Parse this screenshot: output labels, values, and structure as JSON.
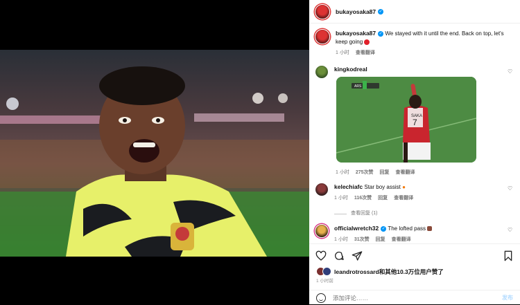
{
  "post": {
    "author": "bukayosaka87",
    "caption": "We stayed with it until the end. Back on top, let's keep going",
    "caption_time": "1 小时",
    "view_translation": "查看翻译"
  },
  "comments": [
    {
      "user": "kingkodreal",
      "has_gif": true,
      "time": "1 小时",
      "likes": "275次赞",
      "reply": "回复",
      "translate": "查看翻译"
    },
    {
      "user": "kelechiafc",
      "text": "Star boy assist",
      "time": "1 小时",
      "likes": "116次赞",
      "reply": "回复",
      "translate": "查看翻译",
      "view_replies": "查看回复 (1)"
    },
    {
      "user": "officialwretch32",
      "text": "The lofted pass",
      "time": "1 小时",
      "likes": "31次赞",
      "reply": "回复",
      "translate": "查看翻译"
    }
  ],
  "likes_text": "leandrotrossard和其他10.3万位用户赞了",
  "post_age": "1 小时前",
  "comment_input": {
    "placeholder": "添加评论……",
    "post_label": "发布"
  },
  "gif_overlay": {
    "score": "ARS",
    "shirt_number": "7",
    "shirt_name": "SAKA"
  },
  "icons": [
    "heart-icon",
    "comment-icon",
    "share-icon",
    "save-icon",
    "emoji-icon",
    "verified-icon"
  ],
  "colors": {
    "verified": "#0095f6",
    "text": "#111111",
    "muted": "#737373"
  }
}
